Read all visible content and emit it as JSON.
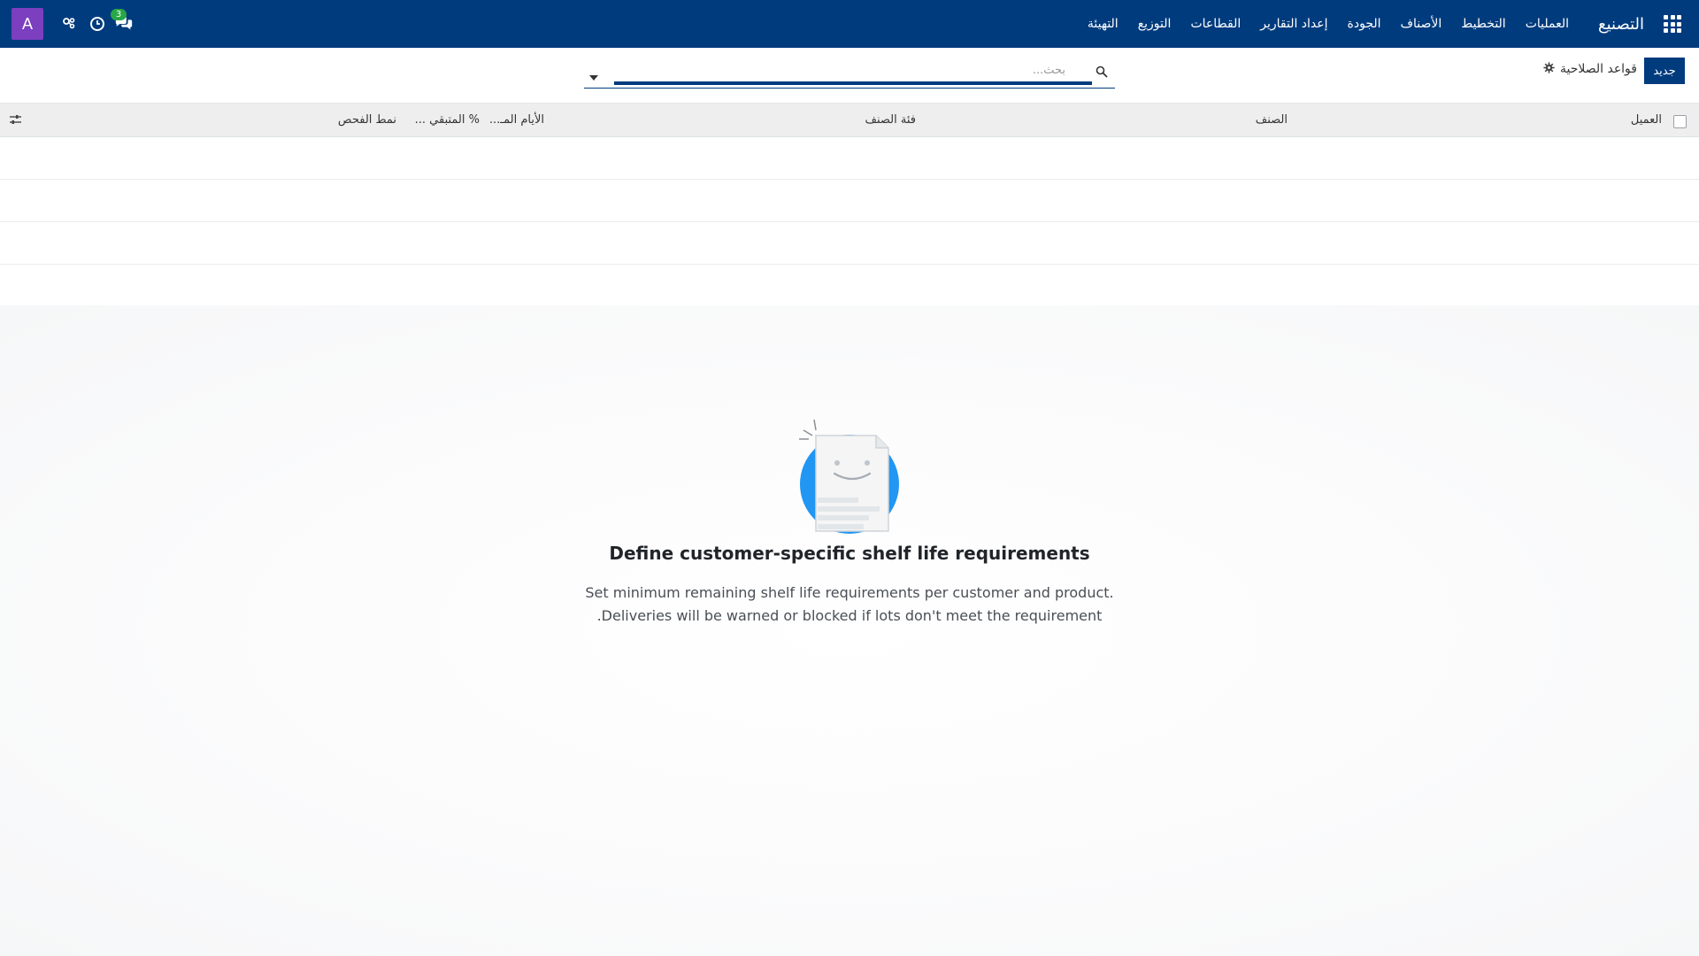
{
  "navbar": {
    "brand": "التصنيع",
    "menu": [
      "العمليات",
      "التخطيط",
      "الأصناف",
      "الجودة",
      "إعداد التقارير",
      "القطاعات",
      "التوزيع",
      "التهيئة"
    ],
    "avatar_letter": "A",
    "chat_count": "3",
    "bg_color": "#003b7e"
  },
  "control_panel": {
    "new_label": "جديد",
    "title": "قواعد الصلاحية",
    "search_placeholder": "بحث..."
  },
  "list": {
    "columns": [
      "العميل",
      "الصنف",
      "فئة الصنف",
      "الأيام المـ...",
      "% المتبقي ...",
      "نمط الفحص"
    ]
  },
  "help": {
    "title": "Define customer-specific shelf life requirements",
    "line1": "Set minimum remaining shelf life requirements per customer and product.",
    "line2": ".Deliveries will be warned or blocked if lots don't meet the requirement"
  },
  "icons": {
    "apps": "apps-grid-icon",
    "settings": "gear-icon",
    "search": "search-icon",
    "dropdown": "caret-down-icon",
    "optional_columns": "sliders-icon",
    "activity": "clock-icon",
    "debug": "bug-icon",
    "messaging": "chat-bubbles-icon"
  }
}
